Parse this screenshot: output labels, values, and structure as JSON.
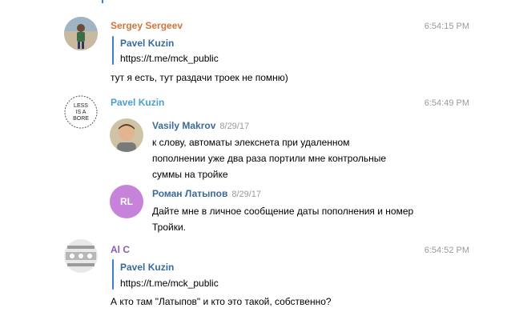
{
  "colors": {
    "sergey_name": "#d0763c",
    "pavel_name": "#4a9fd1",
    "al_name": "#8b5bb6",
    "quote_bar": "#3a7bd5",
    "quote_author": "#3a6a9b",
    "rl_avatar_bg": "#c783d9",
    "time": "#9a9a9a"
  },
  "messages": [
    {
      "sender": "Sergey Sergeev",
      "time": "6:54:15 PM",
      "avatar_icon": "photo-person-icon",
      "quote": {
        "author": "Pavel Kuzin",
        "text": "https://t.me/mck_public"
      },
      "text": "тут я есть, тут раздачи троек не помню)"
    },
    {
      "sender": "Pavel Kuzin",
      "time": "6:54:49 PM",
      "avatar_icon": "less-is-a-bore-icon",
      "avatar_lettering": "LESS IS A BORE",
      "forwarded": [
        {
          "name": "Vasily Makrov",
          "date": "8/29/17",
          "avatar_icon": "photo-person-icon",
          "lines": [
            "к слову, автоматы элекснета при удаленном",
            "пополнении уже два раза портили мне контрольные",
            "суммы на тройке"
          ]
        },
        {
          "name": "Роман Латыпов",
          "date": "8/29/17",
          "initials": "RL",
          "lines": [
            "Дайте мне в личное сообщение даты пополнения и номер",
            "Тройки."
          ]
        }
      ]
    },
    {
      "sender": "Al C",
      "time": "6:54:52 PM",
      "avatar_icon": "pattern-avatar-icon",
      "quote": {
        "author": "Pavel Kuzin",
        "text": "https://t.me/mck_public"
      },
      "text": "А кто там \"Латыпов\" и кто это такой, собственно?"
    }
  ]
}
